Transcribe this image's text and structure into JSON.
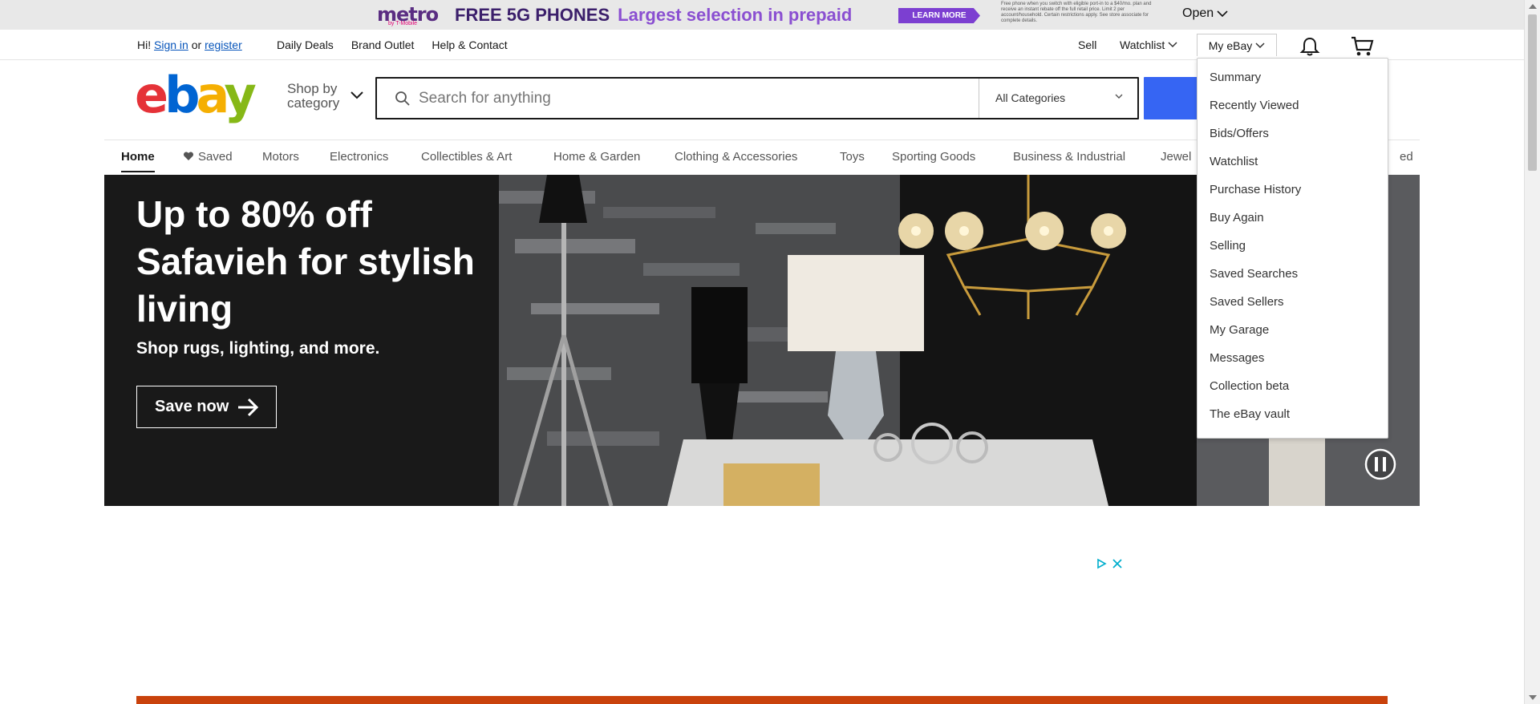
{
  "ad_top": {
    "brand": "metro",
    "brand_sub": "by T-Mobile",
    "headline_1": "FREE 5G PHONES",
    "headline_2": "Largest selection in prepaid",
    "learn_more": "LEARN MORE",
    "fine_print": "Free phone when you switch with eligible port-in to a $40/mo. plan and receive an instant rebate off the full retail price. Limit 2 per account/household. Certain restrictions apply. See store associate for complete details.",
    "open_label": "Open"
  },
  "topnav": {
    "greeting": "Hi!",
    "sign_in": "Sign in",
    "or": "or",
    "register": "register",
    "daily_deals": "Daily Deals",
    "brand_outlet": "Brand Outlet",
    "help_contact": "Help & Contact",
    "sell": "Sell",
    "watchlist": "Watchlist",
    "my_ebay": "My eBay"
  },
  "header": {
    "shop_by_line1": "Shop by",
    "shop_by_line2": "category",
    "search_placeholder": "Search for anything",
    "category_select": "All Categories"
  },
  "catnav": {
    "items": [
      "Home",
      "Saved",
      "Motors",
      "Electronics",
      "Collectibles & Art",
      "Home & Garden",
      "Clothing & Accessories",
      "Toys",
      "Sporting Goods",
      "Business & Industrial",
      "Jewel",
      "ed"
    ]
  },
  "hero": {
    "title": "Up to 80% off Safavieh for stylish living",
    "subtitle": "Shop rugs, lighting, and more.",
    "cta": "Save now"
  },
  "dropdown": {
    "items": [
      "Summary",
      "Recently Viewed",
      "Bids/Offers",
      "Watchlist",
      "Purchase History",
      "Buy Again",
      "Selling",
      "Saved Searches",
      "Saved Sellers",
      "My Garage",
      "Messages",
      "Collection beta",
      "The eBay vault"
    ]
  },
  "colors": {
    "link_blue": "#0654ba",
    "search_button": "#3665f3",
    "hero_bg": "#191919",
    "promo_bar": "#c9420c"
  }
}
